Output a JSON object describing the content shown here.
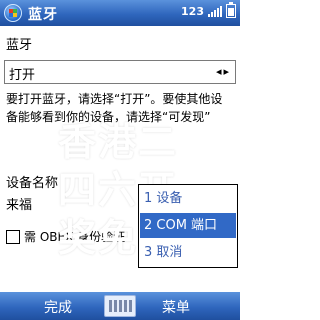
{
  "titlebar": {
    "title": "蓝牙",
    "status_number": "123"
  },
  "main": {
    "section_label": "蓝牙",
    "picker_value": "打开",
    "picker_arrows": "◂▸",
    "description": "要打开蓝牙，请选择“打开”。要使其他设备能够看到你的设备，请选择“可发现”",
    "overlay_text": "香港二四六开奖免",
    "device_name_label": "设备名称",
    "device_name_value": "来福",
    "obex_checkbox_label": "需 OBEX 身份验证"
  },
  "menu": {
    "items": [
      {
        "label": "1 设备"
      },
      {
        "label": "2 COM 端口"
      },
      {
        "label": "3 取消"
      }
    ]
  },
  "softkeys": {
    "left": "完成",
    "right": "菜单"
  },
  "colors": {
    "bar_top": "#5a92dc",
    "bar_bottom": "#1f4f9f",
    "menu_selected": "#3169c6"
  }
}
